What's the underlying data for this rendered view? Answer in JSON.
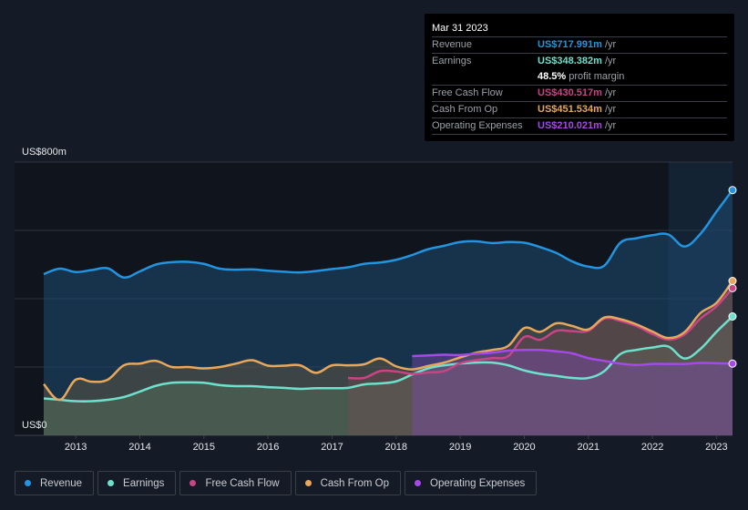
{
  "tooltip": {
    "date": "Mar 31 2023",
    "rows": [
      {
        "label": "Revenue",
        "value": "US$717.991m",
        "unit": "/yr",
        "color": "#2394df"
      },
      {
        "label": "Earnings",
        "value": "US$348.382m",
        "unit": "/yr",
        "color": "#6ee0cc"
      },
      {
        "label": "Free Cash Flow",
        "value": "US$430.517m",
        "unit": "/yr",
        "color": "#c74585"
      },
      {
        "label": "Cash From Op",
        "value": "US$451.534m",
        "unit": "/yr",
        "color": "#e7a85c"
      },
      {
        "label": "Operating Expenses",
        "value": "US$210.021m",
        "unit": "/yr",
        "color": "#a54ae8"
      }
    ],
    "profit_margin": {
      "value": "48.5%",
      "label": "profit margin"
    }
  },
  "legend": [
    {
      "label": "Revenue",
      "color": "#2394df"
    },
    {
      "label": "Earnings",
      "color": "#6ee0cc"
    },
    {
      "label": "Free Cash Flow",
      "color": "#c74585"
    },
    {
      "label": "Cash From Op",
      "color": "#e7a85c"
    },
    {
      "label": "Operating Expenses",
      "color": "#a54ae8"
    }
  ],
  "chart_data": {
    "type": "area",
    "title": "",
    "xlabel": "",
    "ylabel": "",
    "y_top_label": "US$800m",
    "y_bottom_label": "US$0",
    "ylim": [
      0,
      800
    ],
    "xlim": [
      2012.5,
      2023.25
    ],
    "grid": true,
    "x_ticks": [
      "2013",
      "2014",
      "2015",
      "2016",
      "2017",
      "2018",
      "2019",
      "2020",
      "2021",
      "2022",
      "2023"
    ],
    "highlight_range": [
      2022.25,
      2023.25
    ],
    "series": [
      {
        "name": "Revenue",
        "color": "#2394df",
        "unit": "US$m",
        "x": [
          2012.5,
          2012.75,
          2013.0,
          2013.25,
          2013.5,
          2013.75,
          2014.0,
          2014.25,
          2014.5,
          2014.75,
          2015.0,
          2015.25,
          2015.5,
          2015.75,
          2016.0,
          2016.25,
          2016.5,
          2016.75,
          2017.0,
          2017.25,
          2017.5,
          2017.75,
          2018.0,
          2018.25,
          2018.5,
          2018.75,
          2019.0,
          2019.25,
          2019.5,
          2019.75,
          2020.0,
          2020.25,
          2020.5,
          2020.75,
          2021.0,
          2021.25,
          2021.5,
          2021.75,
          2022.0,
          2022.25,
          2022.5,
          2022.75,
          2023.0,
          2023.25
        ],
        "values": [
          472,
          488,
          478,
          484,
          489,
          462,
          480,
          500,
          507,
          508,
          502,
          488,
          485,
          486,
          482,
          479,
          477,
          481,
          487,
          492,
          502,
          506,
          514,
          528,
          545,
          555,
          566,
          568,
          563,
          566,
          564,
          551,
          534,
          509,
          494,
          497,
          564,
          577,
          586,
          588,
          553,
          590,
          655,
          718
        ]
      },
      {
        "name": "Earnings",
        "color": "#6ee0cc",
        "unit": "US$m",
        "x": [
          2012.5,
          2012.75,
          2013.0,
          2013.25,
          2013.5,
          2013.75,
          2014.0,
          2014.25,
          2014.5,
          2014.75,
          2015.0,
          2015.25,
          2015.5,
          2015.75,
          2016.0,
          2016.25,
          2016.5,
          2016.75,
          2017.0,
          2017.25,
          2017.5,
          2017.75,
          2018.0,
          2018.25,
          2018.5,
          2018.75,
          2019.0,
          2019.25,
          2019.5,
          2019.75,
          2020.0,
          2020.25,
          2020.5,
          2020.75,
          2021.0,
          2021.25,
          2021.5,
          2021.75,
          2022.0,
          2022.25,
          2022.5,
          2022.75,
          2023.0,
          2023.25
        ],
        "values": [
          108,
          104,
          100,
          100,
          104,
          112,
          128,
          145,
          154,
          155,
          154,
          147,
          144,
          144,
          141,
          139,
          136,
          138,
          138,
          139,
          149,
          152,
          158,
          178,
          196,
          205,
          210,
          213,
          213,
          205,
          190,
          180,
          174,
          168,
          168,
          188,
          238,
          250,
          257,
          260,
          225,
          253,
          303,
          348
        ]
      },
      {
        "name": "Free Cash Flow",
        "color": "#c74585",
        "unit": "US$m",
        "x": [
          2017.25,
          2017.5,
          2017.75,
          2018.0,
          2018.25,
          2018.5,
          2018.75,
          2019.0,
          2019.25,
          2019.5,
          2019.75,
          2020.0,
          2020.25,
          2020.5,
          2020.75,
          2021.0,
          2021.25,
          2021.5,
          2021.75,
          2022.0,
          2022.25,
          2022.5,
          2022.75,
          2023.0,
          2023.25
        ],
        "values": [
          168,
          168,
          188,
          187,
          180,
          184,
          188,
          211,
          220,
          226,
          232,
          288,
          280,
          306,
          305,
          306,
          342,
          335,
          320,
          297,
          280,
          295,
          342,
          378,
          431
        ]
      },
      {
        "name": "Cash From Op",
        "color": "#e7a85c",
        "unit": "US$m",
        "x": [
          2012.5,
          2012.75,
          2013.0,
          2013.25,
          2013.5,
          2013.75,
          2014.0,
          2014.25,
          2014.5,
          2014.75,
          2015.0,
          2015.25,
          2015.5,
          2015.75,
          2016.0,
          2016.25,
          2016.5,
          2016.75,
          2017.0,
          2017.25,
          2017.5,
          2017.75,
          2018.0,
          2018.25,
          2018.5,
          2018.75,
          2019.0,
          2019.25,
          2019.5,
          2019.75,
          2020.0,
          2020.25,
          2020.5,
          2020.75,
          2021.0,
          2021.25,
          2021.5,
          2021.75,
          2022.0,
          2022.25,
          2022.5,
          2022.75,
          2023.0,
          2023.25
        ],
        "values": [
          150,
          104,
          163,
          157,
          163,
          205,
          210,
          218,
          200,
          200,
          196,
          200,
          210,
          220,
          204,
          204,
          205,
          183,
          205,
          205,
          208,
          225,
          202,
          193,
          203,
          213,
          228,
          242,
          250,
          262,
          314,
          303,
          328,
          320,
          310,
          345,
          340,
          325,
          304,
          285,
          302,
          358,
          388,
          452
        ]
      },
      {
        "name": "Operating Expenses",
        "color": "#a54ae8",
        "unit": "US$m",
        "x": [
          2018.25,
          2018.5,
          2018.75,
          2019.0,
          2019.25,
          2019.5,
          2019.75,
          2020.0,
          2020.25,
          2020.5,
          2020.75,
          2021.0,
          2021.25,
          2021.5,
          2021.75,
          2022.0,
          2022.25,
          2022.5,
          2022.75,
          2023.0,
          2023.25
        ],
        "values": [
          232,
          234,
          236,
          235,
          239,
          242,
          248,
          250,
          250,
          246,
          240,
          226,
          218,
          210,
          206,
          209,
          209,
          209,
          212,
          211,
          210
        ]
      }
    ]
  }
}
